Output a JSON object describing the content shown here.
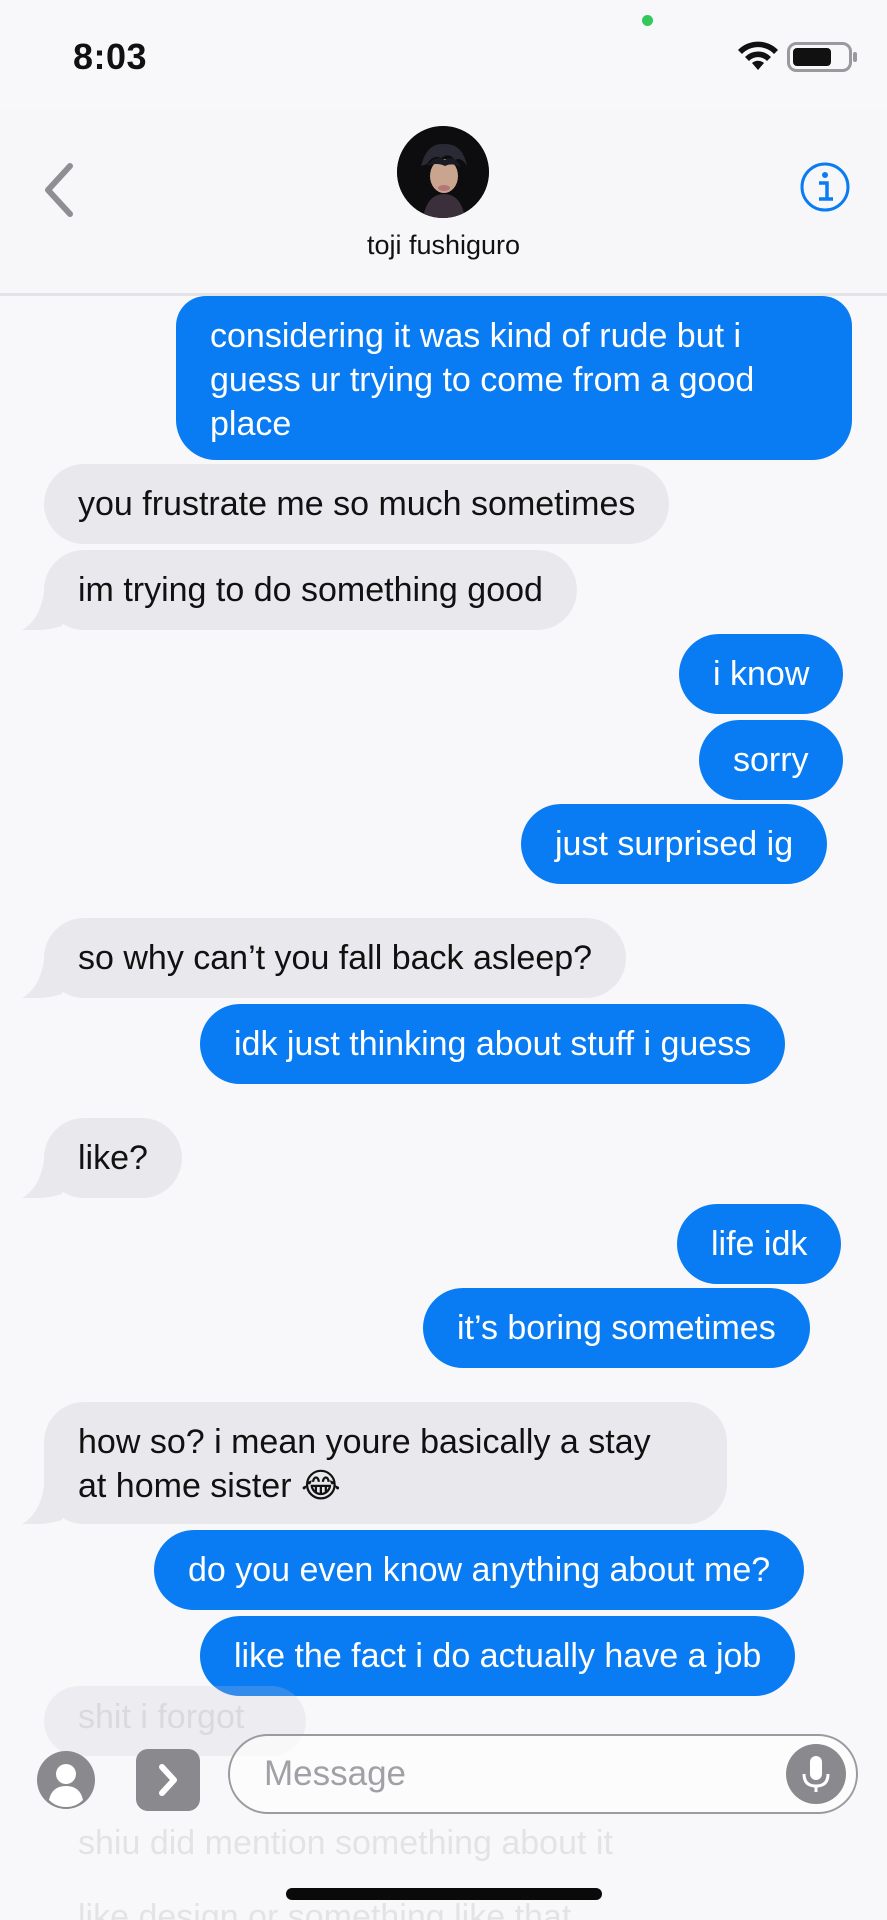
{
  "status_bar": {
    "time": "8:03"
  },
  "header": {
    "contact_name": "toji fushiguro"
  },
  "messages": [
    {
      "dir": "out",
      "text": "considering it was kind of rude but i\nguess ur trying to come from a good\nplace"
    },
    {
      "dir": "in",
      "text": "you frustrate me so much sometimes"
    },
    {
      "dir": "in",
      "text": "im trying to do something good"
    },
    {
      "dir": "out",
      "text": "i know"
    },
    {
      "dir": "out",
      "text": "sorry"
    },
    {
      "dir": "out",
      "text": "just surprised ig"
    },
    {
      "dir": "in",
      "text": "so why can’t you fall back asleep?"
    },
    {
      "dir": "out",
      "text": "idk just thinking about stuff i guess"
    },
    {
      "dir": "in",
      "text": "like?"
    },
    {
      "dir": "out",
      "text": "life idk"
    },
    {
      "dir": "out",
      "text": "it’s boring sometimes"
    },
    {
      "dir": "in",
      "text": "how so? i mean youre basically a stay\nat home sister 😂"
    },
    {
      "dir": "out",
      "text": "do you even know anything about me?"
    },
    {
      "dir": "out",
      "text": "like the fact i do actually have a job"
    }
  ],
  "behind_blur": [
    "shit i forgot",
    "shiu did mention something about it",
    "like design or something like that"
  ],
  "input": {
    "placeholder": "Message"
  },
  "icons": {
    "back": "chevron-left-icon",
    "info": "info-circle-icon",
    "contact": "person-circle-icon",
    "apps": "chevron-right-icon",
    "mic": "microphone-icon"
  },
  "colors": {
    "outgoing_bubble": "#0a7cf3",
    "incoming_bubble": "#e9e9ed",
    "accent": "#0a7cf3"
  }
}
